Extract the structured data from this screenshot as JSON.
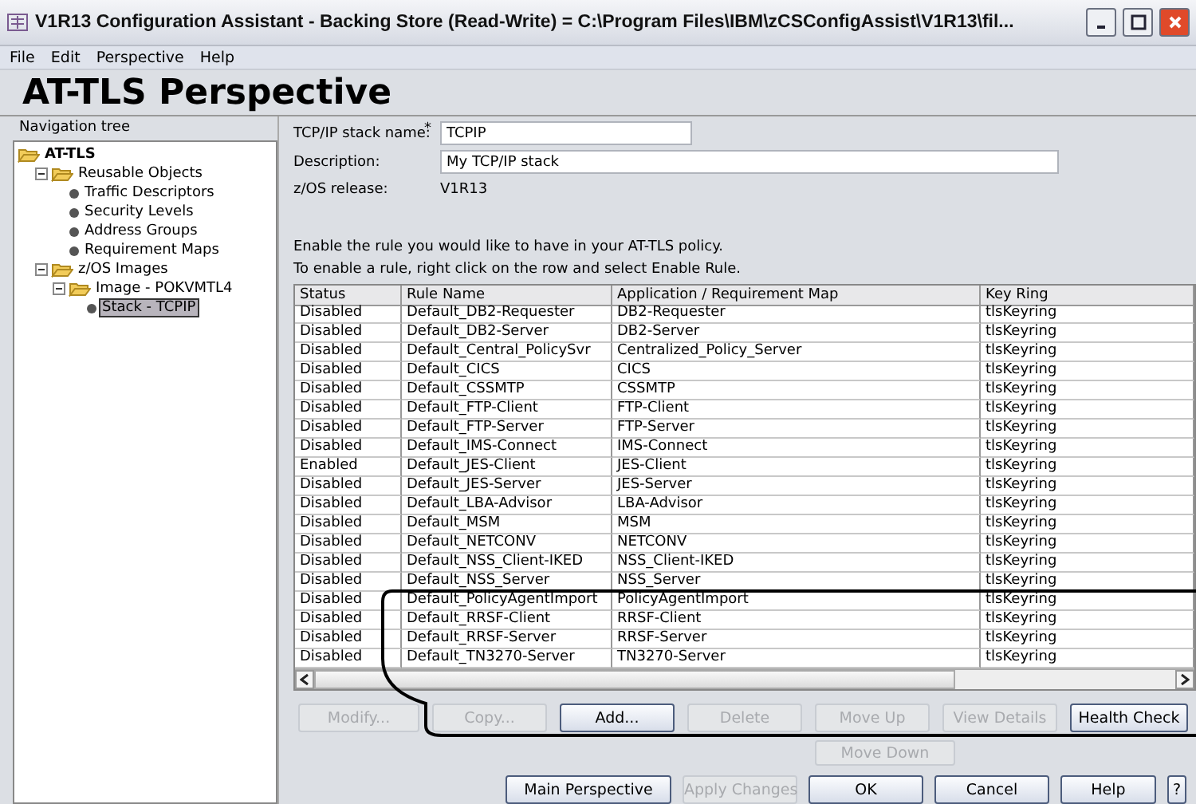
{
  "window": {
    "title": "V1R13 Configuration Assistant - Backing Store (Read-Write) = C:\\Program Files\\IBM\\zCSConfigAssist\\V1R13\\fil..."
  },
  "menu": [
    "File",
    "Edit",
    "Perspective",
    "Help"
  ],
  "heading": "AT-TLS Perspective",
  "navigation": {
    "title": "Navigation tree",
    "tree": [
      {
        "label": "AT-TLS",
        "kind": "folder",
        "expanded": true,
        "selected": false,
        "children": [
          {
            "label": "Reusable Objects",
            "kind": "folder",
            "expanded": true,
            "selected": false,
            "children": [
              {
                "label": "Traffic Descriptors",
                "kind": "leaf",
                "selected": false
              },
              {
                "label": "Security Levels",
                "kind": "leaf",
                "selected": false
              },
              {
                "label": "Address Groups",
                "kind": "leaf",
                "selected": false
              },
              {
                "label": "Requirement Maps",
                "kind": "leaf",
                "selected": false
              }
            ]
          },
          {
            "label": "z/OS Images",
            "kind": "folder",
            "expanded": true,
            "selected": false,
            "children": [
              {
                "label": "Image - POKVMTL4",
                "kind": "folder",
                "expanded": true,
                "selected": false,
                "children": [
                  {
                    "label": "Stack - TCPIP",
                    "kind": "leaf",
                    "selected": true
                  }
                ]
              }
            ]
          }
        ]
      }
    ]
  },
  "form": {
    "stack_name": {
      "label": "TCP/IP stack name:",
      "required_mark": "*",
      "value": "TCPIP"
    },
    "description": {
      "label": "Description:",
      "value": "My TCP/IP stack"
    },
    "release": {
      "label": "z/OS release:",
      "value": "V1R13"
    },
    "instructions": [
      "Enable the rule you would like to have in your AT-TLS policy.",
      "To enable a rule, right click on the row and select Enable Rule."
    ]
  },
  "table": {
    "columns": [
      "Status",
      "Rule Name",
      "Application / Requirement Map",
      "Key Ring"
    ],
    "rows": [
      [
        "Disabled",
        "Default_DB2-Requester",
        "DB2-Requester",
        "tlsKeyring"
      ],
      [
        "Disabled",
        "Default_DB2-Server",
        "DB2-Server",
        "tlsKeyring"
      ],
      [
        "Disabled",
        "Default_Central_PolicySvr",
        "Centralized_Policy_Server",
        "tlsKeyring"
      ],
      [
        "Disabled",
        "Default_CICS",
        "CICS",
        "tlsKeyring"
      ],
      [
        "Disabled",
        "Default_CSSMTP",
        "CSSMTP",
        "tlsKeyring"
      ],
      [
        "Disabled",
        "Default_FTP-Client",
        "FTP-Client",
        "tlsKeyring"
      ],
      [
        "Disabled",
        "Default_FTP-Server",
        "FTP-Server",
        "tlsKeyring"
      ],
      [
        "Disabled",
        "Default_IMS-Connect",
        "IMS-Connect",
        "tlsKeyring"
      ],
      [
        "Enabled",
        "Default_JES-Client",
        "JES-Client",
        "tlsKeyring"
      ],
      [
        "Disabled",
        "Default_JES-Server",
        "JES-Server",
        "tlsKeyring"
      ],
      [
        "Disabled",
        "Default_LBA-Advisor",
        "LBA-Advisor",
        "tlsKeyring"
      ],
      [
        "Disabled",
        "Default_MSM",
        "MSM",
        "tlsKeyring"
      ],
      [
        "Disabled",
        "Default_NETCONV",
        "NETCONV",
        "tlsKeyring"
      ],
      [
        "Disabled",
        "Default_NSS_Client-IKED",
        "NSS_Client-IKED",
        "tlsKeyring"
      ],
      [
        "Disabled",
        "Default_NSS_Server",
        "NSS_Server",
        "tlsKeyring"
      ],
      [
        "Disabled",
        "Default_PolicyAgentImport",
        "PolicyAgentImport",
        "tlsKeyring"
      ],
      [
        "Disabled",
        "Default_RRSF-Client",
        "RRSF-Client",
        "tlsKeyring"
      ],
      [
        "Disabled",
        "Default_RRSF-Server",
        "RRSF-Server",
        "tlsKeyring"
      ],
      [
        "Disabled",
        "Default_TN3270-Server",
        "TN3270-Server",
        "tlsKeyring"
      ]
    ]
  },
  "action_buttons": [
    {
      "label": "Modify...",
      "disabled": true
    },
    {
      "label": "Copy...",
      "disabled": true
    },
    {
      "label": "Add...",
      "disabled": false
    },
    {
      "label": "Delete",
      "disabled": true
    },
    {
      "label": "Move Up",
      "disabled": true
    },
    {
      "label": "View Details",
      "disabled": true
    },
    {
      "label": "Health Check",
      "disabled": false
    }
  ],
  "move_down": {
    "label": "Move Down",
    "disabled": true
  },
  "footer_buttons": [
    {
      "label": "Main Perspective",
      "disabled": false
    },
    {
      "label": "Apply Changes",
      "disabled": true
    },
    {
      "label": "OK",
      "disabled": false
    },
    {
      "label": "Cancel",
      "disabled": false
    },
    {
      "label": "Help",
      "disabled": false
    },
    {
      "label": "?",
      "disabled": false
    }
  ]
}
